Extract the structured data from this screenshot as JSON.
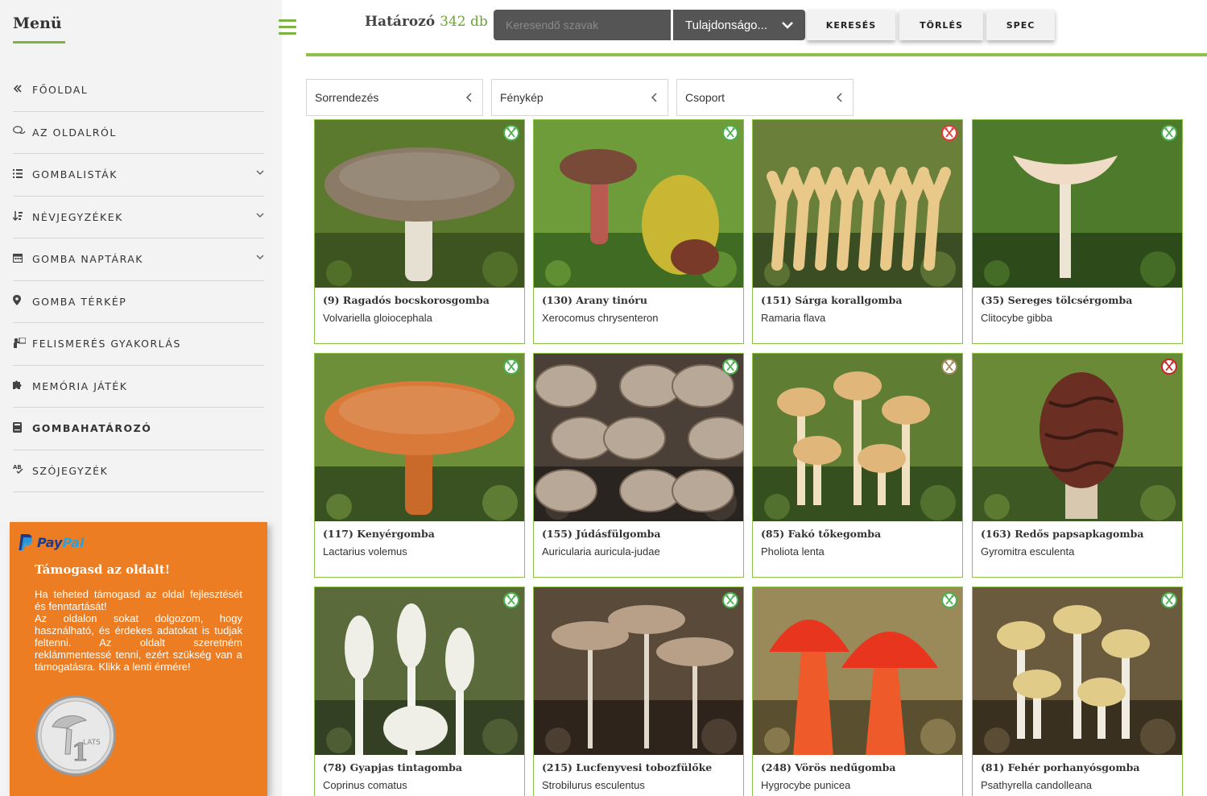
{
  "sidebar": {
    "title": "Menü",
    "items": [
      {
        "label": "FŐOLDAL",
        "icon": "double-chevron-left-icon",
        "has_sub": false,
        "active": false
      },
      {
        "label": "AZ OLDALRÓL",
        "icon": "chat-bubbles-icon",
        "has_sub": false,
        "active": false
      },
      {
        "label": "GOMBALISTÁK",
        "icon": "list-icon",
        "has_sub": true,
        "active": false
      },
      {
        "label": "NÉVJEGYZÉKEK",
        "icon": "sort-icon",
        "has_sub": true,
        "active": false
      },
      {
        "label": "GOMBA NAPTÁRAK",
        "icon": "calendar-icon",
        "has_sub": true,
        "active": false
      },
      {
        "label": "GOMBA TÉRKÉP",
        "icon": "map-pin-icon",
        "has_sub": false,
        "active": false
      },
      {
        "label": "FELISMERÉS GYAKORLÁS",
        "icon": "teacher-icon",
        "has_sub": false,
        "active": false
      },
      {
        "label": "MEMÓRIA JÁTÉK",
        "icon": "puzzle-icon",
        "has_sub": false,
        "active": false
      },
      {
        "label": "GOMBAHATÁROZÓ",
        "icon": "book-icon",
        "has_sub": false,
        "active": true
      },
      {
        "label": "SZÓJEGYZÉK",
        "icon": "spell-check-icon",
        "has_sub": false,
        "active": false
      }
    ]
  },
  "paypal": {
    "logo_pay": "Pay",
    "logo_pal": "Pal",
    "title": "Támogasd az oldalt!",
    "p1": "Ha teheted támogasd az oldal fejlesztését és fenntartását!",
    "p2": "Az oldalon sokat dolgozom, hogy használható, és érdekes adatokat is tudjak feltenni. Az oldalt szeretném reklámmentessé tenni, ezért szükség van a támogatásra. Klikk a lenti érmére!",
    "coin_value": "1",
    "coin_text": "LATS",
    "card_color": "#ed7d22"
  },
  "header": {
    "title": "Határozó",
    "count": "342 db",
    "search_placeholder": "Keresendő szavak",
    "property_select": "Tulajdonságo...",
    "buttons": {
      "search": "KERESÉS",
      "clear": "TÖRLÉS",
      "spec": "SPEC"
    },
    "accent": "#8bc34a"
  },
  "filters": [
    {
      "label": "Sorrendezés"
    },
    {
      "label": "Fénykép"
    },
    {
      "label": "Csoport"
    }
  ],
  "cards": [
    {
      "name": "(9) Ragadós bocskorosgomba",
      "latin": "Volvariella gloiocephala",
      "edibility": "edible",
      "photo": {
        "bg": [
          "#5b7a2e",
          "#3e5420"
        ],
        "cap": "#8a7a66",
        "stem": "#e6e0d2",
        "kind": "cap"
      }
    },
    {
      "name": "(130) Arany tinóru",
      "latin": "Xerocomus chrysenteron",
      "edibility": "edible",
      "photo": {
        "bg": [
          "#6f9c3a",
          "#3f6b23"
        ],
        "cap": "#7a4a38",
        "stem": "#b85a50",
        "kind": "bolete"
      }
    },
    {
      "name": "(151) Sárga korallgomba",
      "latin": "Ramaria flava",
      "edibility": "poisonous",
      "photo": {
        "bg": [
          "#6a7f3a",
          "#3b4d22"
        ],
        "cap": "#e8c98a",
        "stem": "#f0dcaa",
        "kind": "coral"
      }
    },
    {
      "name": "(35) Sereges tölcsérgomba",
      "latin": "Clitocybe gibba",
      "edibility": "edible",
      "photo": {
        "bg": [
          "#4e7a2c",
          "#2d4a1a"
        ],
        "cap": "#f0dcc6",
        "stem": "#eee4d4",
        "kind": "funnel"
      }
    },
    {
      "name": "(117) Kenyérgomba",
      "latin": "Lactarius volemus",
      "edibility": "edible",
      "photo": {
        "bg": [
          "#6d8f3a",
          "#3a5222"
        ],
        "cap": "#d97a3a",
        "stem": "#c96a2a",
        "kind": "cap"
      }
    },
    {
      "name": "(155) Júdásfülgomba",
      "latin": "Auricularia auricula-judae",
      "edibility": "edible",
      "photo": {
        "bg": [
          "#4a4038",
          "#2a2420"
        ],
        "cap": "#b8a898",
        "stem": "#9a8878",
        "kind": "ear"
      }
    },
    {
      "name": "(85) Fakó tőkegomba",
      "latin": "Pholiota lenta",
      "edibility": "inedible",
      "photo": {
        "bg": [
          "#5f7e34",
          "#35501e"
        ],
        "cap": "#e0b67a",
        "stem": "#f0e0c0",
        "kind": "cluster"
      }
    },
    {
      "name": "(163) Redős papsapkagomba",
      "latin": "Gyromitra esculenta",
      "edibility": "deadly",
      "photo": {
        "bg": [
          "#6a8a38",
          "#3e5824"
        ],
        "cap": "#6a2e22",
        "stem": "#d8c8b0",
        "kind": "brain"
      }
    },
    {
      "name": "(78) Gyapjas tintagomba",
      "latin": "Coprinus comatus",
      "edibility": "edible",
      "photo": {
        "bg": [
          "#5a6a3a",
          "#344024"
        ],
        "cap": "#efefe8",
        "stem": "#f4f4ee",
        "kind": "shaggy"
      }
    },
    {
      "name": "(215) Lucfenyvesi tobozfülőke",
      "latin": "Strobilurus esculentus",
      "edibility": "edible",
      "photo": {
        "bg": [
          "#5a4a3a",
          "#2e241c"
        ],
        "cap": "#b8a088",
        "stem": "#e0d8c8",
        "kind": "thin"
      }
    },
    {
      "name": "(248) Vörös nedűgomba",
      "latin": "Hygrocybe punicea",
      "edibility": "edible",
      "photo": {
        "bg": [
          "#9a8a5a",
          "#5a5030"
        ],
        "cap": "#e8351e",
        "stem": "#ee5a2a",
        "kind": "waxcap"
      }
    },
    {
      "name": "(81) Fehér porhanyósgomba",
      "latin": "Psathyrella candolleana",
      "edibility": "edible",
      "photo": {
        "bg": [
          "#6a5a3e",
          "#3a3020"
        ],
        "cap": "#e0cc88",
        "stem": "#f0ece2",
        "kind": "cluster"
      }
    }
  ],
  "edibility_colors": {
    "edible": "#4caf50",
    "poisonous": "#e53935",
    "inedible": "#a08a5a",
    "deadly": "#c62828"
  }
}
